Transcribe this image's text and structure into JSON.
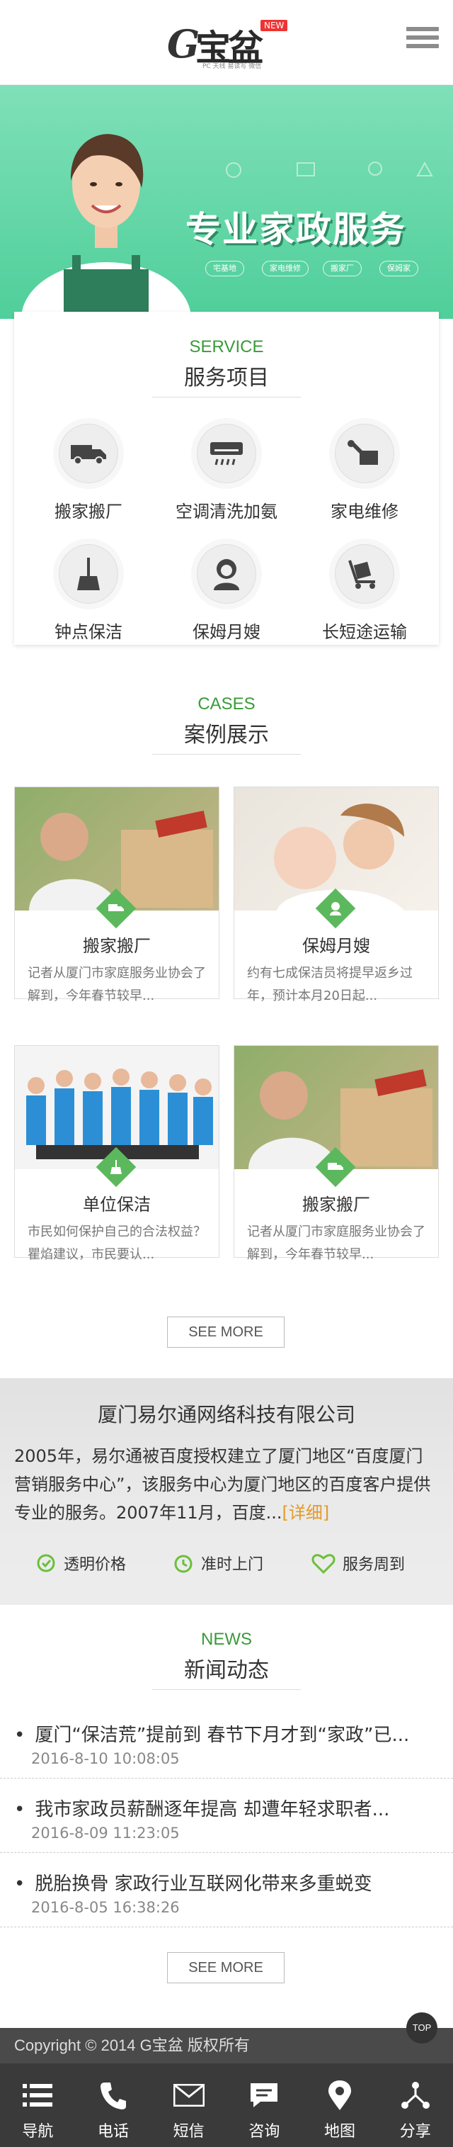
{
  "header": {
    "logo_letter": "G",
    "logo_text": "宝盆",
    "logo_badge": "NEW",
    "logo_tagline": "PC 天线 易读写 微信"
  },
  "banner": {
    "title": "专业家政服务",
    "buttons": [
      "宅基地",
      "家电维修",
      "搬家厂",
      "保姆家"
    ]
  },
  "services": {
    "en": "SERVICE",
    "cn": "服务项目",
    "items": [
      {
        "label": "搬家搬厂",
        "icon": "truck-icon"
      },
      {
        "label": "空调清洗加氨",
        "icon": "air-conditioner-icon"
      },
      {
        "label": "家电维修",
        "icon": "repair-icon"
      },
      {
        "label": "钟点保洁",
        "icon": "broom-icon"
      },
      {
        "label": "保姆月嫂",
        "icon": "nanny-icon"
      },
      {
        "label": "长短途运输",
        "icon": "trolley-icon"
      }
    ]
  },
  "cases": {
    "en": "CASES",
    "cn": "案例展示",
    "items": [
      {
        "title": "搬家搬厂",
        "desc": "记者从厦门市家庭服务业协会了解到，今年春节较早..."
      },
      {
        "title": "保姆月嫂",
        "desc": "约有七成保洁员将提早返乡过年，预计本月20日起..."
      },
      {
        "title": "单位保洁",
        "desc": "市民如何保护自己的合法权益？瞿焰建议，市民要认..."
      },
      {
        "title": "搬家搬厂",
        "desc": "记者从厦门市家庭服务业协会了解到，今年春节较早..."
      }
    ],
    "more": "SEE MORE"
  },
  "about": {
    "title": "厦门易尔通网络科技有限公司",
    "text": "2005年，易尔通被百度授权建立了厦门地区“百度厦门营销服务中心”，该服务中心为厦门地区的百度客户提供专业的服务。2007年11月，百度...",
    "more": "[详细]",
    "features": [
      "透明价格",
      "准时上门",
      "服务周到"
    ]
  },
  "news": {
    "en": "NEWS",
    "cn": "新闻动态",
    "items": [
      {
        "title": "厦门“保洁荒”提前到 春节下月才到“家政”已...",
        "date": "2016-8-10  10:08:05"
      },
      {
        "title": "我市家政员薪酬逐年提高 却遭年轻求职者...",
        "date": "2016-8-09  11:23:05"
      },
      {
        "title": "脱胎换骨 家政行业互联网化带来多重蜕变",
        "date": "2016-8-05  16:38:26"
      }
    ],
    "more": "SEE MORE"
  },
  "footer": {
    "copyright": "Copyright © 2014 G宝盆 版权所有",
    "top": "TOP",
    "nav": [
      {
        "label": "导航",
        "icon": "menu-icon"
      },
      {
        "label": "电话",
        "icon": "phone-icon"
      },
      {
        "label": "短信",
        "icon": "mail-icon"
      },
      {
        "label": "咨询",
        "icon": "chat-icon"
      },
      {
        "label": "地图",
        "icon": "map-pin-icon"
      },
      {
        "label": "分享",
        "icon": "share-icon"
      }
    ]
  }
}
